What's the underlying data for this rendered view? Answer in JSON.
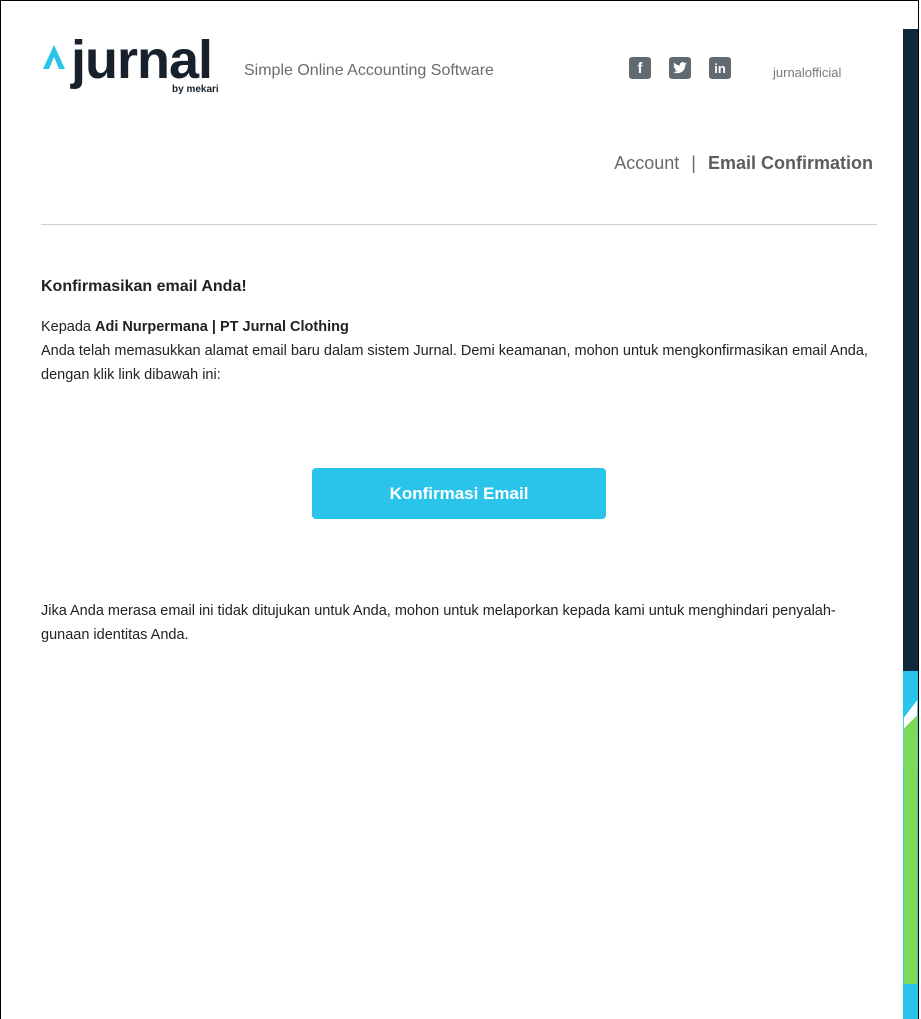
{
  "brand": {
    "logo_text": "jurnal",
    "logo_sub": "by mekari",
    "tagline": "Simple Online Accounting Software",
    "accent_color": "#2ac3ea"
  },
  "social": {
    "icons": [
      "facebook-icon",
      "twitter-icon",
      "linkedin-icon"
    ],
    "handle": "jurnalofficial"
  },
  "breadcrumb": {
    "parent": "Account",
    "separator": "|",
    "current": "Email Confirmation"
  },
  "email": {
    "heading": "Konfirmasikan email Anda!",
    "greeting_prefix": "Kepada",
    "recipient": "Adi Nurpermana | PT Jurnal Clothing",
    "body": "Anda telah memasukkan alamat email baru dalam sistem Jurnal. Demi keamanan, mohon untuk mengkonfirmasikan email Anda, dengan klik link dibawah ini:",
    "button_label": "Konfirmasi Email",
    "footnote": "Jika Anda merasa email ini tidak ditujukan untuk Anda, mohon untuk melaporkan kepada kami untuk menghindari penyalah-gunaan identitas Anda."
  }
}
